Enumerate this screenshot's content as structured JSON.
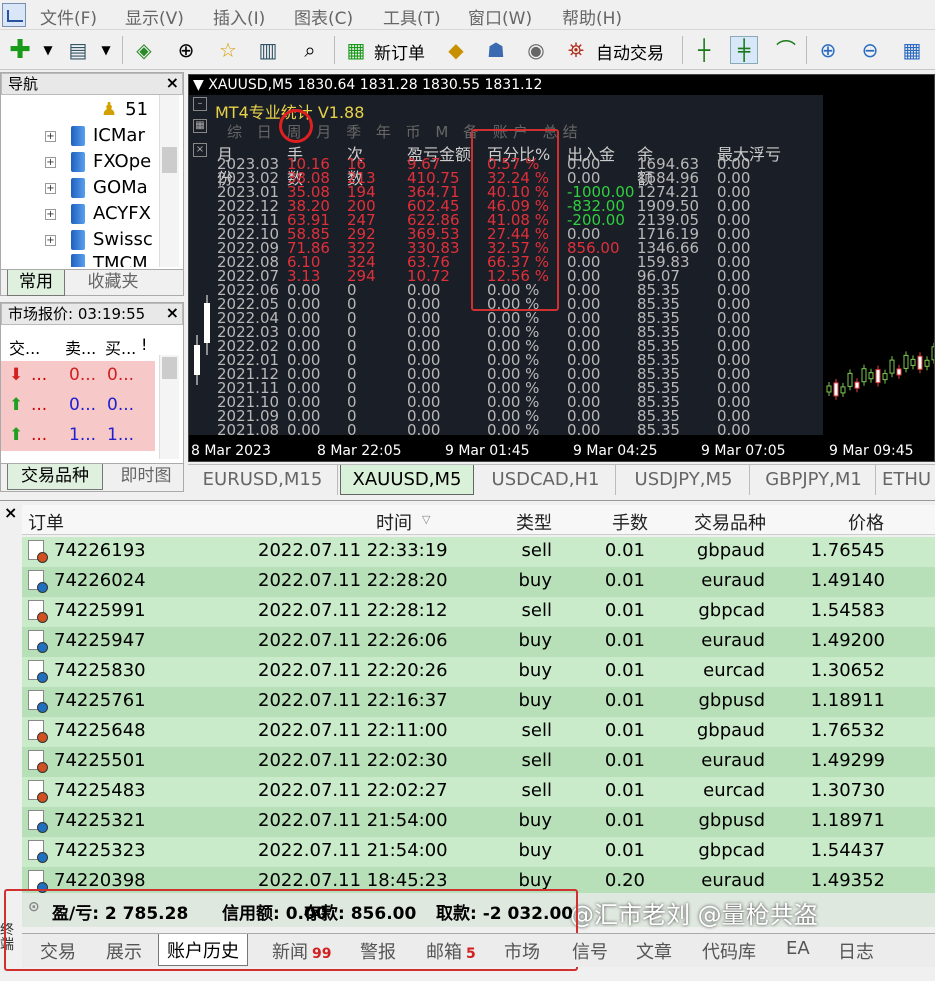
{
  "menu": {
    "items": [
      "文件(F)",
      "显示(V)",
      "插入(I)",
      "图表(C)",
      "工具(T)",
      "窗口(W)",
      "帮助(H)"
    ]
  },
  "toolbar": {
    "new_order": "新订单",
    "auto_trade": "自动交易"
  },
  "navigator": {
    "title": "导航",
    "items": [
      "51",
      "ICMar",
      "FXOpe",
      "GOMa",
      "ACYFX",
      "Swissc",
      "TMCM"
    ],
    "tabs": [
      "常用",
      "收藏夹"
    ]
  },
  "market_watch": {
    "title": "市场报价: 03:19:55",
    "headers": [
      "交...",
      "卖...",
      "买...",
      "!"
    ],
    "rows": [
      {
        "sym": "...",
        "bid": "0...",
        "ask": "0..."
      },
      {
        "sym": "...",
        "bid": "0...",
        "ask": "0..."
      },
      {
        "sym": "...",
        "bid": "1...",
        "ask": "1..."
      }
    ],
    "tabs": [
      "交易品种",
      "即时图"
    ]
  },
  "chart": {
    "info": "XAUUSD,M5  1830.64 1831.28 1830.55 1831.12",
    "ea_title": "MT4专业统计 V1.88",
    "ea_tabs": "综 日 周 月 季 年 币 M 备 账户 总结",
    "headers": [
      "月份",
      "手数",
      "次数",
      "盈亏金额",
      "百分比%",
      "出入金",
      "余额",
      "最大浮亏"
    ],
    "months": [
      "2023.03",
      "2023.02",
      "2023.01",
      "2022.12",
      "2022.11",
      "2022.10",
      "2022.09",
      "2022.08",
      "2022.07",
      "2022.06",
      "2022.05",
      "2022.04",
      "2022.03",
      "2022.02",
      "2022.01",
      "2021.12",
      "2021.11",
      "2021.10",
      "2021.09",
      "2021.08"
    ],
    "lots": [
      "10.16",
      "38.08",
      "35.08",
      "38.20",
      "63.91",
      "58.85",
      "71.86",
      "6.10",
      "3.13",
      "0.00",
      "0.00",
      "0.00",
      "0.00",
      "0.00",
      "0.00",
      "0.00",
      "0.00",
      "0.00",
      "0.00",
      "0.00"
    ],
    "counts": [
      "16",
      "213",
      "194",
      "200",
      "247",
      "292",
      "322",
      "324",
      "294",
      "0",
      "0",
      "0",
      "0",
      "0",
      "0",
      "0",
      "0",
      "0",
      "0",
      "0"
    ],
    "pnl": [
      "9.67",
      "410.75",
      "364.71",
      "602.45",
      "622.86",
      "369.53",
      "330.83",
      "63.76",
      "10.72",
      "0.00",
      "0.00",
      "0.00",
      "0.00",
      "0.00",
      "0.00",
      "0.00",
      "0.00",
      "0.00",
      "0.00",
      "0.00"
    ],
    "pct": [
      "0.57 %",
      "32.24 %",
      "40.10 %",
      "46.09 %",
      "41.08 %",
      "27.44 %",
      "32.57 %",
      "66.37 %",
      "12.56 %",
      "0.00 %",
      "0.00 %",
      "0.00 %",
      "0.00 %",
      "0.00 %",
      "0.00 %",
      "0.00 %",
      "0.00 %",
      "0.00 %",
      "0.00 %",
      "0.00 %"
    ],
    "deposit": [
      "0.00",
      "0.00",
      "-1000.00",
      "-832.00",
      "-200.00",
      "0.00",
      "856.00",
      "0.00",
      "0.00",
      "0.00",
      "0.00",
      "0.00",
      "0.00",
      "0.00",
      "0.00",
      "0.00",
      "0.00",
      "0.00",
      "0.00",
      "0.00"
    ],
    "balance": [
      "1694.63",
      "1684.96",
      "1274.21",
      "1909.50",
      "2139.05",
      "1716.19",
      "1346.66",
      "159.83",
      "96.07",
      "85.35",
      "85.35",
      "85.35",
      "85.35",
      "85.35",
      "85.35",
      "85.35",
      "85.35",
      "85.35",
      "85.35",
      "85.35"
    ],
    "maxdd": [
      "0.00",
      "0.00",
      "0.00",
      "0.00",
      "0.00",
      "0.00",
      "0.00",
      "0.00",
      "0.00",
      "0.00",
      "0.00",
      "0.00",
      "0.00",
      "0.00",
      "0.00",
      "0.00",
      "0.00",
      "0.00",
      "0.00",
      "0.00"
    ],
    "times": [
      "8 Mar 2023",
      "8 Mar 22:05",
      "9 Mar 01:45",
      "9 Mar 04:25",
      "9 Mar 07:05",
      "9 Mar 09:45"
    ]
  },
  "chart_tabs": [
    "EURUSD,M15",
    "XAUUSD,M5",
    "USDCAD,H1",
    "USDJPY,M5",
    "GBPJPY,M1",
    "ETHU"
  ],
  "terminal": {
    "headers": [
      "订单",
      "时间",
      "类型",
      "手数",
      "交易品种",
      "价格"
    ],
    "rows": [
      {
        "order": "74226193",
        "time": "2022.07.11 22:33:19",
        "type": "sell",
        "lots": "0.01",
        "symbol": "gbpaud",
        "price": "1.76545"
      },
      {
        "order": "74226024",
        "time": "2022.07.11 22:28:20",
        "type": "buy",
        "lots": "0.01",
        "symbol": "euraud",
        "price": "1.49140"
      },
      {
        "order": "74225991",
        "time": "2022.07.11 22:28:12",
        "type": "sell",
        "lots": "0.01",
        "symbol": "gbpcad",
        "price": "1.54583"
      },
      {
        "order": "74225947",
        "time": "2022.07.11 22:26:06",
        "type": "buy",
        "lots": "0.01",
        "symbol": "euraud",
        "price": "1.49200"
      },
      {
        "order": "74225830",
        "time": "2022.07.11 22:20:26",
        "type": "buy",
        "lots": "0.01",
        "symbol": "eurcad",
        "price": "1.30652"
      },
      {
        "order": "74225761",
        "time": "2022.07.11 22:16:37",
        "type": "buy",
        "lots": "0.01",
        "symbol": "gbpusd",
        "price": "1.18911"
      },
      {
        "order": "74225648",
        "time": "2022.07.11 22:11:00",
        "type": "sell",
        "lots": "0.01",
        "symbol": "gbpaud",
        "price": "1.76532"
      },
      {
        "order": "74225501",
        "time": "2022.07.11 22:02:30",
        "type": "sell",
        "lots": "0.01",
        "symbol": "euraud",
        "price": "1.49299"
      },
      {
        "order": "74225483",
        "time": "2022.07.11 22:02:27",
        "type": "sell",
        "lots": "0.01",
        "symbol": "eurcad",
        "price": "1.30730"
      },
      {
        "order": "74225321",
        "time": "2022.07.11 21:54:00",
        "type": "buy",
        "lots": "0.01",
        "symbol": "gbpusd",
        "price": "1.18971"
      },
      {
        "order": "74225323",
        "time": "2022.07.11 21:54:00",
        "type": "buy",
        "lots": "0.01",
        "symbol": "gbpcad",
        "price": "1.54437"
      },
      {
        "order": "74220398",
        "time": "2022.07.11 18:45:23",
        "type": "buy",
        "lots": "0.20",
        "symbol": "euraud",
        "price": "1.49352"
      }
    ],
    "summary": {
      "pnl": "盈/亏: 2 785.28",
      "credit": "信用额: 0.00",
      "deposit": "存款: 856.00",
      "withdraw": "取款: -2 032.00"
    },
    "watermark": "@汇市老刘 @量枪共盗",
    "side_label": "终端",
    "tabs": [
      "交易",
      "展示",
      "账户历史",
      "新闻",
      "警报",
      "邮箱",
      "市场",
      "信号",
      "文章",
      "代码库",
      "EA",
      "日志"
    ],
    "news_badge": "99",
    "mail_badge": "5"
  },
  "colors": {
    "ea_red": "#e0303a",
    "ea_green": "#30d040",
    "ea_gray": "#b8b8b8",
    "row_a": "#c9ebc9",
    "row_b": "#b8e0b8"
  }
}
